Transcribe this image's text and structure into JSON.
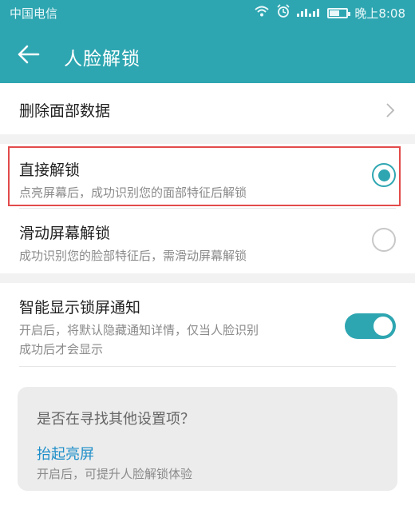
{
  "status_bar": {
    "carrier": "中国电信",
    "time": "晚上8:08",
    "icons": [
      "wifi-icon",
      "alarm-icon",
      "signal-icon",
      "battery-icon"
    ],
    "battery_level": 0.6
  },
  "app_bar": {
    "title": "人脸解锁",
    "back_icon": "arrow-left-icon"
  },
  "rows": {
    "delete": {
      "title": "删除面部数据"
    },
    "direct_unlock": {
      "title": "直接解锁",
      "desc": "点亮屏幕后，成功识别您的面部特征后解锁",
      "selected": true
    },
    "slide_unlock": {
      "title": "滑动屏幕解锁",
      "desc": "成功识别您的脸部特征后，需滑动屏幕解锁",
      "selected": false
    },
    "smart_notify": {
      "title": "智能显示锁屏通知",
      "desc_line1": "开启后，将默认隐藏通知详情，仅当人脸识别",
      "desc_line2": "成功后才会显示",
      "enabled": true
    }
  },
  "suggestion": {
    "question": "是否在寻找其他设置项？",
    "link": "抬起亮屏",
    "desc": "开启后，可提升人脸解锁体验"
  },
  "colors": {
    "accent": "#2ea6b1",
    "highlight": "#e34b4b",
    "link": "#1f8fc9"
  }
}
